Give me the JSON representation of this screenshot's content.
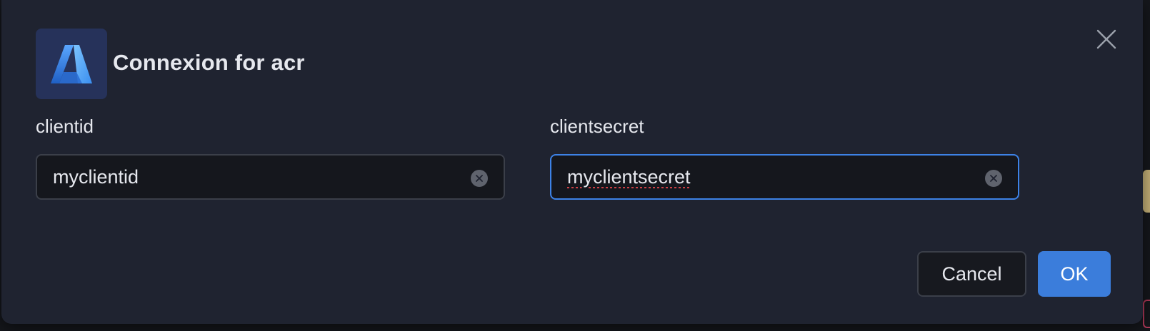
{
  "dialog": {
    "title": "Connexion for acr",
    "logo_icon": "azure-logo-icon",
    "close_icon": "close-icon"
  },
  "fields": [
    {
      "label": "clientid",
      "value": "myclientid",
      "focused": false
    },
    {
      "label": "clientsecret",
      "value": "myclientsecret",
      "focused": true
    }
  ],
  "actions": {
    "cancel_label": "Cancel",
    "ok_label": "OK"
  },
  "colors": {
    "dialog_bg": "#1f2330",
    "accent": "#3b7ddb",
    "focus_border": "#3d82e6",
    "text": "#e6e8ee",
    "logo_bg": "#26325a"
  }
}
